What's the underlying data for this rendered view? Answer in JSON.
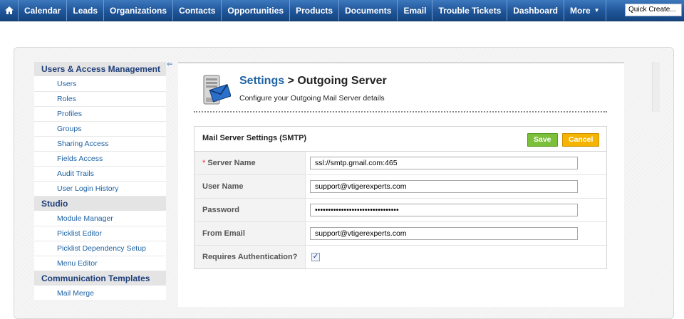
{
  "nav": {
    "tabs": [
      "Calendar",
      "Leads",
      "Organizations",
      "Contacts",
      "Opportunities",
      "Products",
      "Documents",
      "Email",
      "Trouble Tickets",
      "Dashboard"
    ],
    "more": "More",
    "quick_create": "Quick Create..."
  },
  "sidebar": {
    "sections": [
      {
        "title": "Users & Access Management",
        "items": [
          "Users",
          "Roles",
          "Profiles",
          "Groups",
          "Sharing Access",
          "Fields Access",
          "Audit Trails",
          "User Login History"
        ]
      },
      {
        "title": "Studio",
        "items": [
          "Module Manager",
          "Picklist Editor",
          "Picklist Dependency Setup",
          "Menu Editor"
        ]
      },
      {
        "title": "Communication Templates",
        "items": [
          "Mail Merge"
        ]
      }
    ]
  },
  "header": {
    "breadcrumb_link": "Settings",
    "breadcrumb_sep": " > ",
    "title": "Outgoing Server",
    "subtitle": "Configure your Outgoing Mail Server details"
  },
  "form": {
    "title": "Mail Server Settings (SMTP)",
    "save_label": "Save",
    "cancel_label": "Cancel",
    "server_name_label": "Server Name",
    "server_name_value": "ssl://smtp.gmail.com:465",
    "user_name_label": "User Name",
    "user_name_value": "support@vtigerexperts.com",
    "password_label": "Password",
    "password_value": "••••••••••••••••••••••••••••••••",
    "from_email_label": "From Email",
    "from_email_value": "support@vtigerexperts.com",
    "auth_label": "Requires Authentication?",
    "auth_checked": true
  }
}
